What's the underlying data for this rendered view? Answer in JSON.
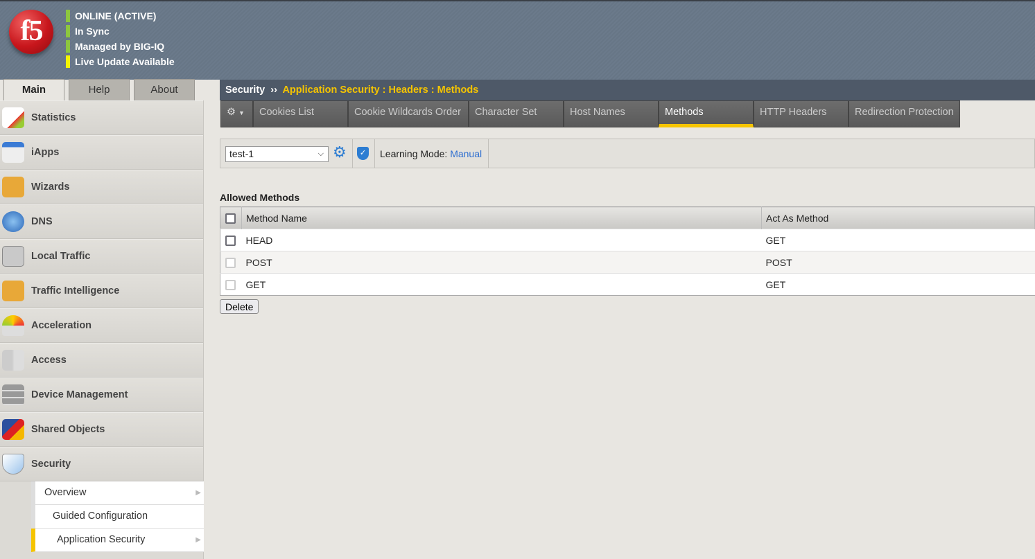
{
  "header": {
    "logo": "f5",
    "status": [
      {
        "text": "ONLINE (ACTIVE)",
        "color": "#8dc63f"
      },
      {
        "text": "In Sync",
        "color": "#8dc63f"
      },
      {
        "text": "Managed by BIG-IQ",
        "color": "#8dc63f"
      },
      {
        "text": "Live Update Available",
        "color": "#f5f500"
      }
    ]
  },
  "top_tabs": [
    "Main",
    "Help",
    "About"
  ],
  "sidebar": {
    "items": [
      "Statistics",
      "iApps",
      "Wizards",
      "DNS",
      "Local Traffic",
      "Traffic Intelligence",
      "Acceleration",
      "Access",
      "Device Management",
      "Shared Objects",
      "Security"
    ],
    "submenu": [
      "Overview",
      "Guided Configuration",
      "Application Security"
    ]
  },
  "breadcrumb": {
    "root": "Security",
    "sep": "››",
    "path": "Application Security : Headers : Methods"
  },
  "tabs": [
    "Cookies List",
    "Cookie Wildcards Order",
    "Character Set",
    "Host Names",
    "Methods",
    "HTTP Headers",
    "Redirection Protection"
  ],
  "toolbar": {
    "policy": "test-1",
    "learning_label": "Learning Mode:",
    "learning_value": "Manual"
  },
  "table": {
    "title": "Allowed Methods",
    "columns": [
      "Method Name",
      "Act As Method"
    ],
    "rows": [
      {
        "name": "HEAD",
        "act": "GET",
        "enabled": true
      },
      {
        "name": "POST",
        "act": "POST",
        "enabled": false
      },
      {
        "name": "GET",
        "act": "GET",
        "enabled": false
      }
    ]
  },
  "delete_label": "Delete"
}
